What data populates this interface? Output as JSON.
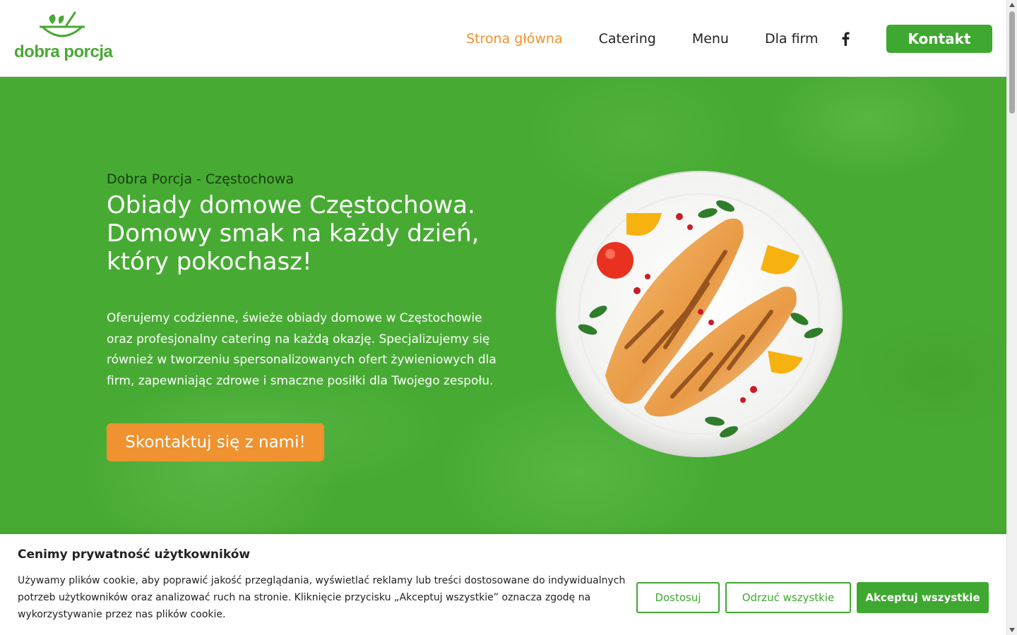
{
  "header": {
    "logo_text": "dobra porcja",
    "nav": {
      "home": "Strona główna",
      "catering": "Catering",
      "menu": "Menu",
      "business": "Dla firm"
    },
    "social_icon": "facebook-icon",
    "contact_button": "Kontakt"
  },
  "hero": {
    "subtitle": "Dobra Porcja - Częstochowa",
    "title": "Obiady domowe Częstochowa. Domowy smak na każdy dzień, który pokochasz!",
    "description": "Oferujemy codzienne, świeże obiady domowe w Częstochowie oraz profesjonalny catering na każdą okazję. Specjalizujemy się również w tworzeniu spersonalizowanych ofert żywieniowych dla firm, zapewniając zdrowe i smaczne posiłki dla Twojego zespołu.",
    "cta_button": "Skontaktuj się z nami!"
  },
  "cookie": {
    "title": "Cenimy prywatność użytkowników",
    "text": "Używamy plików cookie, aby poprawić jakość przeglądania, wyświetlać reklamy lub treści dostosowane do indywidualnych potrzeb użytkowników oraz analizować ruch na stronie. Kliknięcie przycisku „Akceptuj wszystkie” oznacza zgodę na wykorzystywanie przez nas plików cookie.",
    "customize": "Dostosuj",
    "reject_all": "Odrzuć wszystkie",
    "accept_all": "Akceptuj wszystkie"
  },
  "colors": {
    "brand_green": "#3fa830",
    "accent_orange": "#ef922f",
    "hero_bg": "#47ab33"
  }
}
